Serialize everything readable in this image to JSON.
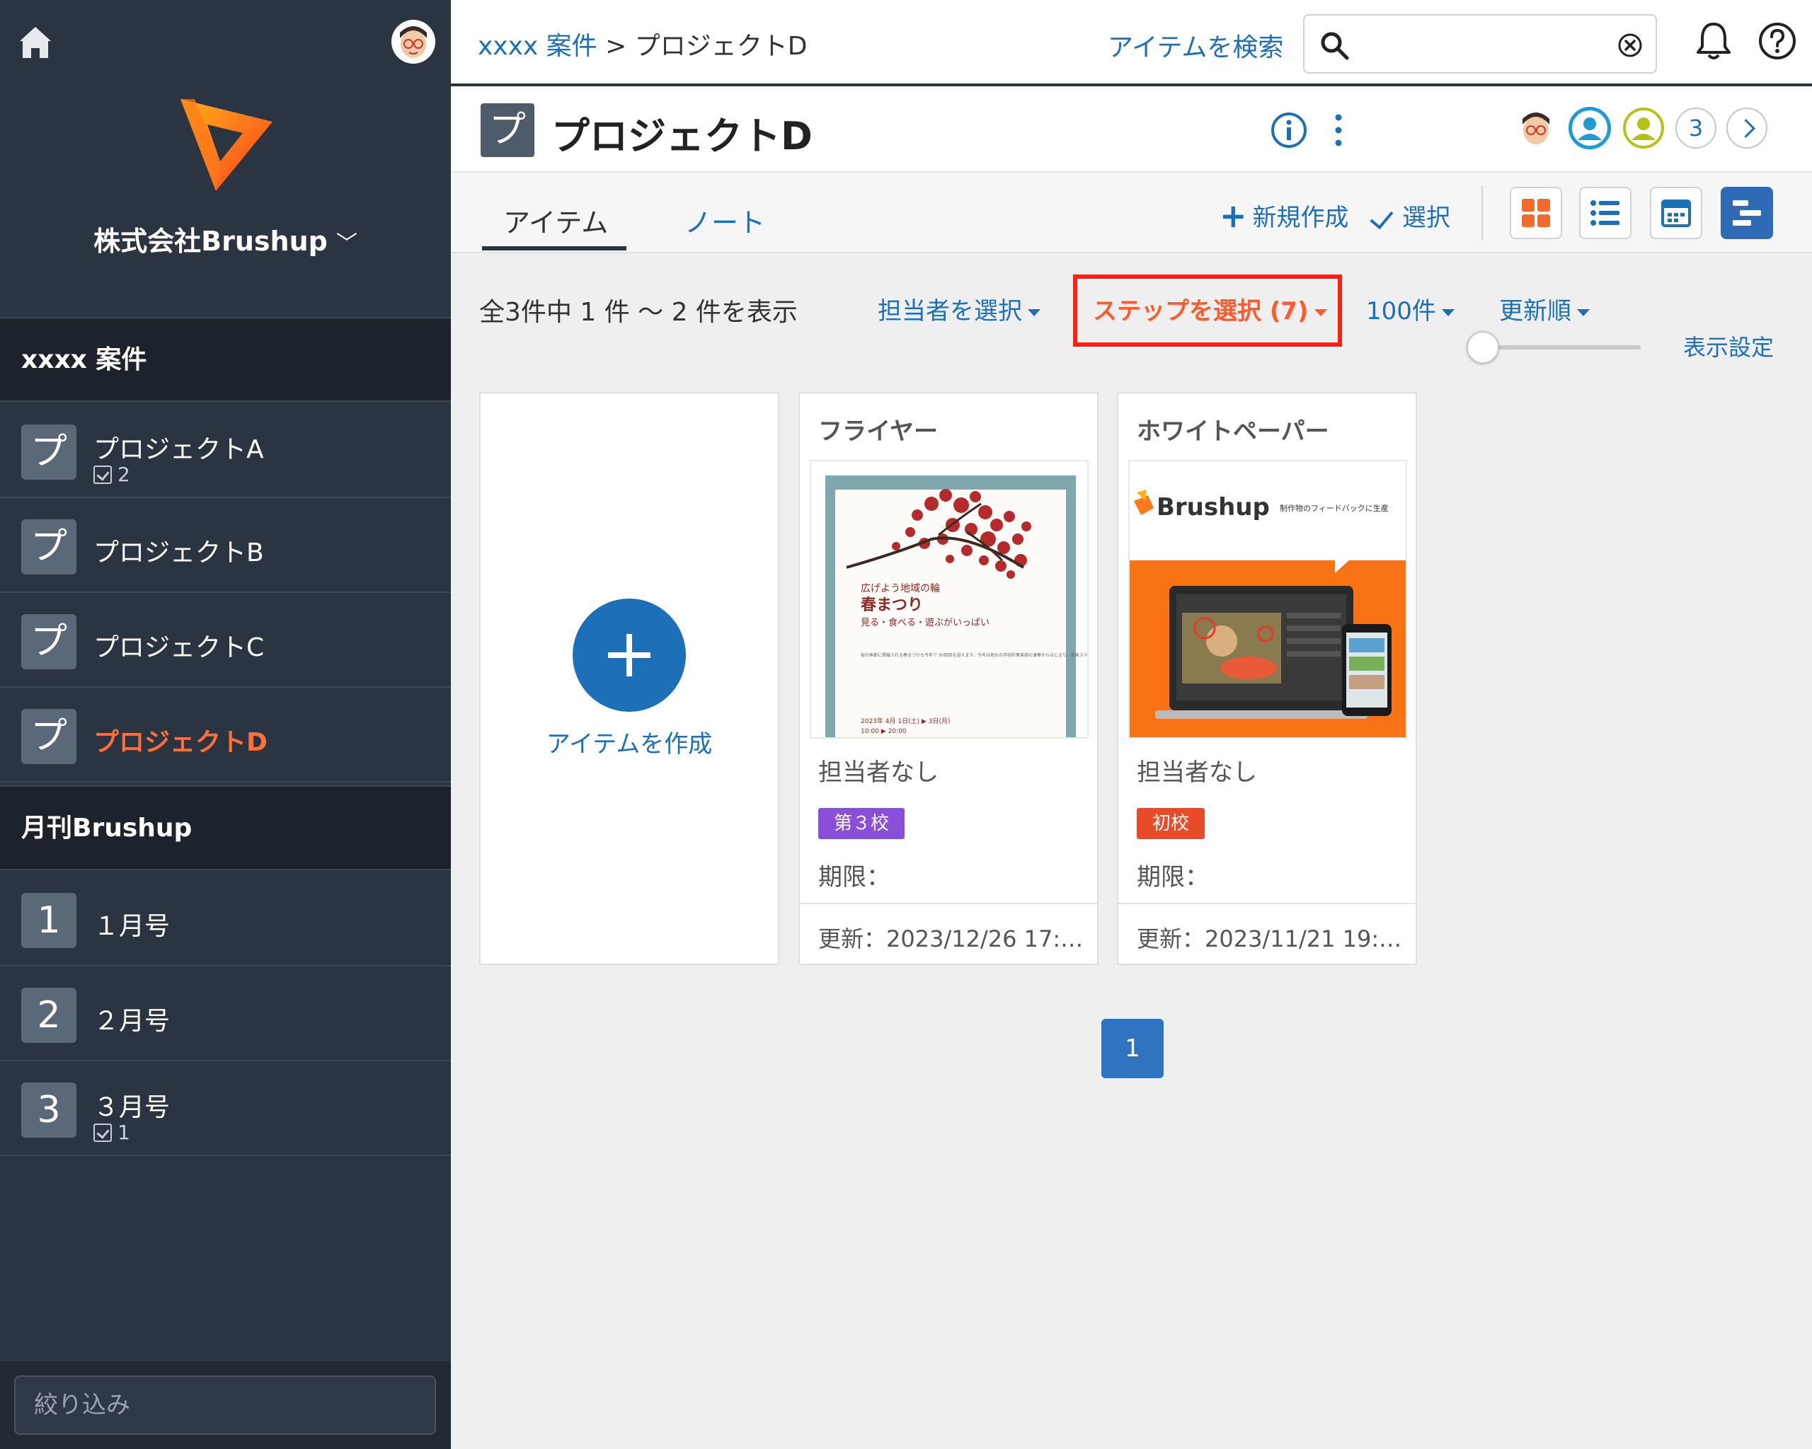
{
  "sidebar": {
    "company": "株式会社Brushup",
    "sections": [
      {
        "title": "xxxx 案件",
        "items": [
          {
            "badge": "プ",
            "label": "プロジェクトA",
            "count": "2"
          },
          {
            "badge": "プ",
            "label": "プロジェクトB"
          },
          {
            "badge": "プ",
            "label": "プロジェクトC"
          },
          {
            "badge": "プ",
            "label": "プロジェクトD"
          }
        ]
      },
      {
        "title": "月刊Brushup",
        "items": [
          {
            "badge": "1",
            "label": "１月号"
          },
          {
            "badge": "2",
            "label": "２月号"
          },
          {
            "badge": "3",
            "label": "３月号",
            "count": "1"
          }
        ]
      }
    ],
    "filter_placeholder": "絞り込み"
  },
  "topbar": {
    "breadcrumb_link": "xxxx 案件",
    "breadcrumb_sep": " > ",
    "breadcrumb_current": "プロジェクトD",
    "search_link": "アイテムを検索",
    "search_value": ""
  },
  "project": {
    "badge": "プ",
    "title": "プロジェクトD",
    "member_extra_count": "3"
  },
  "tabs": {
    "items": "アイテム",
    "notes": "ノート"
  },
  "actions": {
    "new": "新規作成",
    "select": "選択"
  },
  "filters": {
    "count_text": "全3件中 1 件 〜 2 件を表示",
    "assignee": "担当者を選択",
    "step": "ステップを選択 (7)",
    "per_page": "100件",
    "sort": "更新順",
    "display_setting": "表示設定"
  },
  "create_card": {
    "label": "アイテムを作成"
  },
  "items": [
    {
      "title": "フライヤー",
      "assignee": "担当者なし",
      "step": "第３校",
      "step_color": "#8a4fd8",
      "deadline": "期限：",
      "updated": "更新：2023/12/26 17:…",
      "thumb": {
        "heading": "広げよう地域の輪",
        "title": "春まつり",
        "subtitle": "見る・食べる・遊ぶがいっぱい",
        "body": "桜の季節に開催される春まつりも今年で 30回目を迎えます。今年は地元の学校吹奏楽部の演奏からはじまり、音楽ステージやダンスステージなど子どもから大人まで一日楽しめるイベントです。会場内では各種出展・協賛団体の模擬店などイベント、一般参加のフリーマーケットを開催し、フィナーレには花火大会と盛り沢山です。ぜひ、ご家族でお越しください。",
        "date": "2023年 4月 1日(土) ▶ 3日(月)",
        "time": "10:00 ▶ 20:00"
      }
    },
    {
      "title": "ホワイトペーパー",
      "assignee": "担当者なし",
      "step": "初校",
      "step_color": "#e84b2a",
      "deadline": "期限：",
      "updated": "更新：2023/11/21 19:…",
      "thumb": {
        "brand": "Brushup",
        "tagline": "制作物のフィードバックに生産"
      }
    }
  ],
  "pagination": {
    "current": "1"
  },
  "colors": {
    "sidebar_bg": "#2b3441",
    "accent_blue": "#1d6fb8",
    "active_orange": "#ff6f3c",
    "highlight_red": "#ff1f10"
  },
  "icons": [
    "home-icon",
    "user-avatar-icon",
    "brushup-logo-icon",
    "chevron-down-icon",
    "search-icon",
    "clear-icon",
    "bell-icon",
    "help-icon",
    "info-icon",
    "more-vertical-icon",
    "grid-view-icon",
    "list-view-icon",
    "calendar-view-icon",
    "gantt-view-icon",
    "plus-icon",
    "checkmark-icon",
    "caret-down-icon"
  ]
}
